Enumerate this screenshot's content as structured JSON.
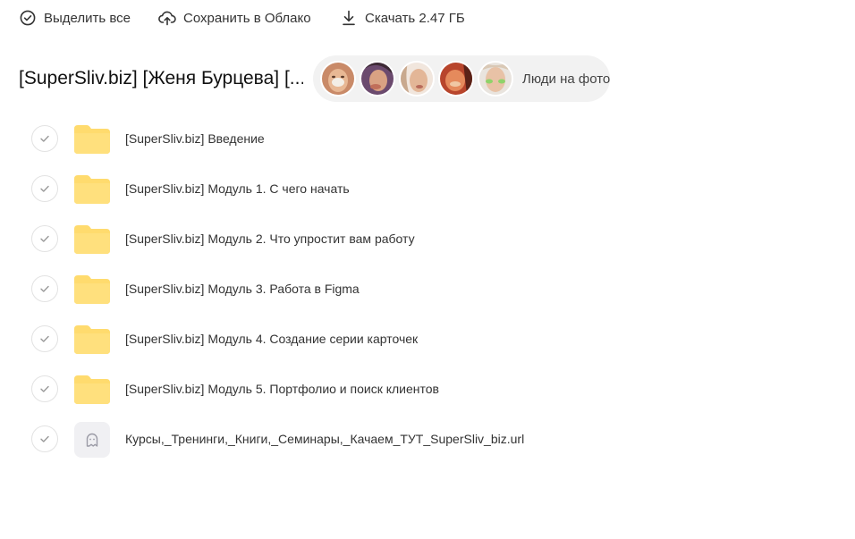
{
  "toolbar": {
    "select_all_label": "Выделить все",
    "save_label": "Сохранить в Облако",
    "download_label": "Скачать 2.47 ГБ"
  },
  "folder": {
    "title": "[SuperSliv.biz] [Женя Бурцева] [..."
  },
  "people": {
    "label": "Люди на фото",
    "avatar_count": 5
  },
  "files": [
    {
      "name": "[SuperSliv.biz] Введение",
      "type": "folder"
    },
    {
      "name": "[SuperSliv.biz] Модуль 1. С чего начать",
      "type": "folder"
    },
    {
      "name": "[SuperSliv.biz] Модуль 2. Что упростит вам работу",
      "type": "folder"
    },
    {
      "name": "[SuperSliv.biz] Модуль 3. Работа в Figma",
      "type": "folder"
    },
    {
      "name": "[SuperSliv.biz] Модуль 4. Создание серии карточек",
      "type": "folder"
    },
    {
      "name": "[SuperSliv.biz] Модуль 5. Портфолио и поиск клиентов",
      "type": "folder"
    },
    {
      "name": "Курсы,_Тренинги,_Книги,_Семинары,_Качаем_ТУТ_SuperSliv_biz.url",
      "type": "link"
    }
  ],
  "colors": {
    "folder": "#FFDB6E",
    "pill_bg": "#f2f2f2",
    "check_border": "#e2e2e2"
  }
}
